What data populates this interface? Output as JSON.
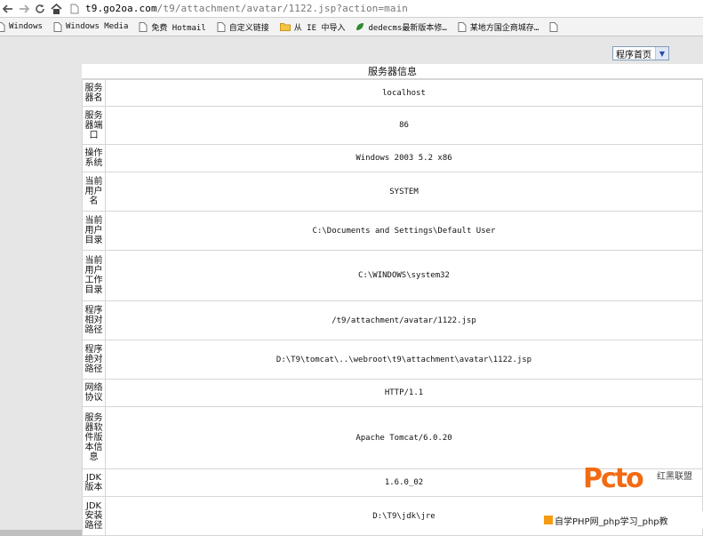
{
  "browser": {
    "url_host": "t9.go2oa.com",
    "url_path": "/t9/attachment/avatar/1122.jsp?action=main"
  },
  "bookmarks": [
    {
      "label": "Windows",
      "icon": "page-icon"
    },
    {
      "label": "Windows Media",
      "icon": "page-icon"
    },
    {
      "label": "免费 Hotmail",
      "icon": "page-icon"
    },
    {
      "label": "自定义链接",
      "icon": "page-icon"
    },
    {
      "label": "从 IE 中导入",
      "icon": "folder-icon"
    },
    {
      "label": "dedecms最新版本修…",
      "icon": "green-leaf-icon"
    },
    {
      "label": "某地方国企商城存…",
      "icon": "page-icon"
    },
    {
      "label": "",
      "icon": "page-icon"
    }
  ],
  "select": {
    "value": "程序首页"
  },
  "panel": {
    "caption": "服务器信息",
    "rows": [
      {
        "label": "服务器名",
        "value": "localhost",
        "h": 30
      },
      {
        "label": "服务器端口",
        "value": "86",
        "h": 43
      },
      {
        "label": "操作系统",
        "value": "Windows 2003 5.2 x86",
        "h": 31
      },
      {
        "label": "当前用户名",
        "value": "SYSTEM",
        "h": 44
      },
      {
        "label": "当前用户目录",
        "value": "C:\\Documents and Settings\\Default User",
        "h": 44
      },
      {
        "label": "当前用户工作目录",
        "value": "C:\\WINDOWS\\system32",
        "h": 57
      },
      {
        "label": "程序相对路径",
        "value": "/t9/attachment/avatar/1122.jsp",
        "h": 44
      },
      {
        "label": "程序绝对路径",
        "value": "D:\\T9\\tomcat\\..\\webroot\\t9\\attachment\\avatar\\1122.jsp",
        "h": 44
      },
      {
        "label": "网络协议",
        "value": "HTTP/1.1",
        "h": 31
      },
      {
        "label": "服务器软件版本信息",
        "value": "Apache Tomcat/6.0.20",
        "h": 70
      },
      {
        "label": "JDK版本",
        "value": "1.6.0_02",
        "h": 31
      },
      {
        "label": "JDK安装路径",
        "value": "D:\\T9\\jdk\\jre",
        "h": 44
      }
    ]
  },
  "watermark": {
    "logo": "Pcto",
    "tag": "红黑联盟",
    "bar": "自学PHP网_php学习_php教"
  },
  "colors": {
    "page_bg": "#e6e6e6",
    "accent": "#f26b12"
  }
}
